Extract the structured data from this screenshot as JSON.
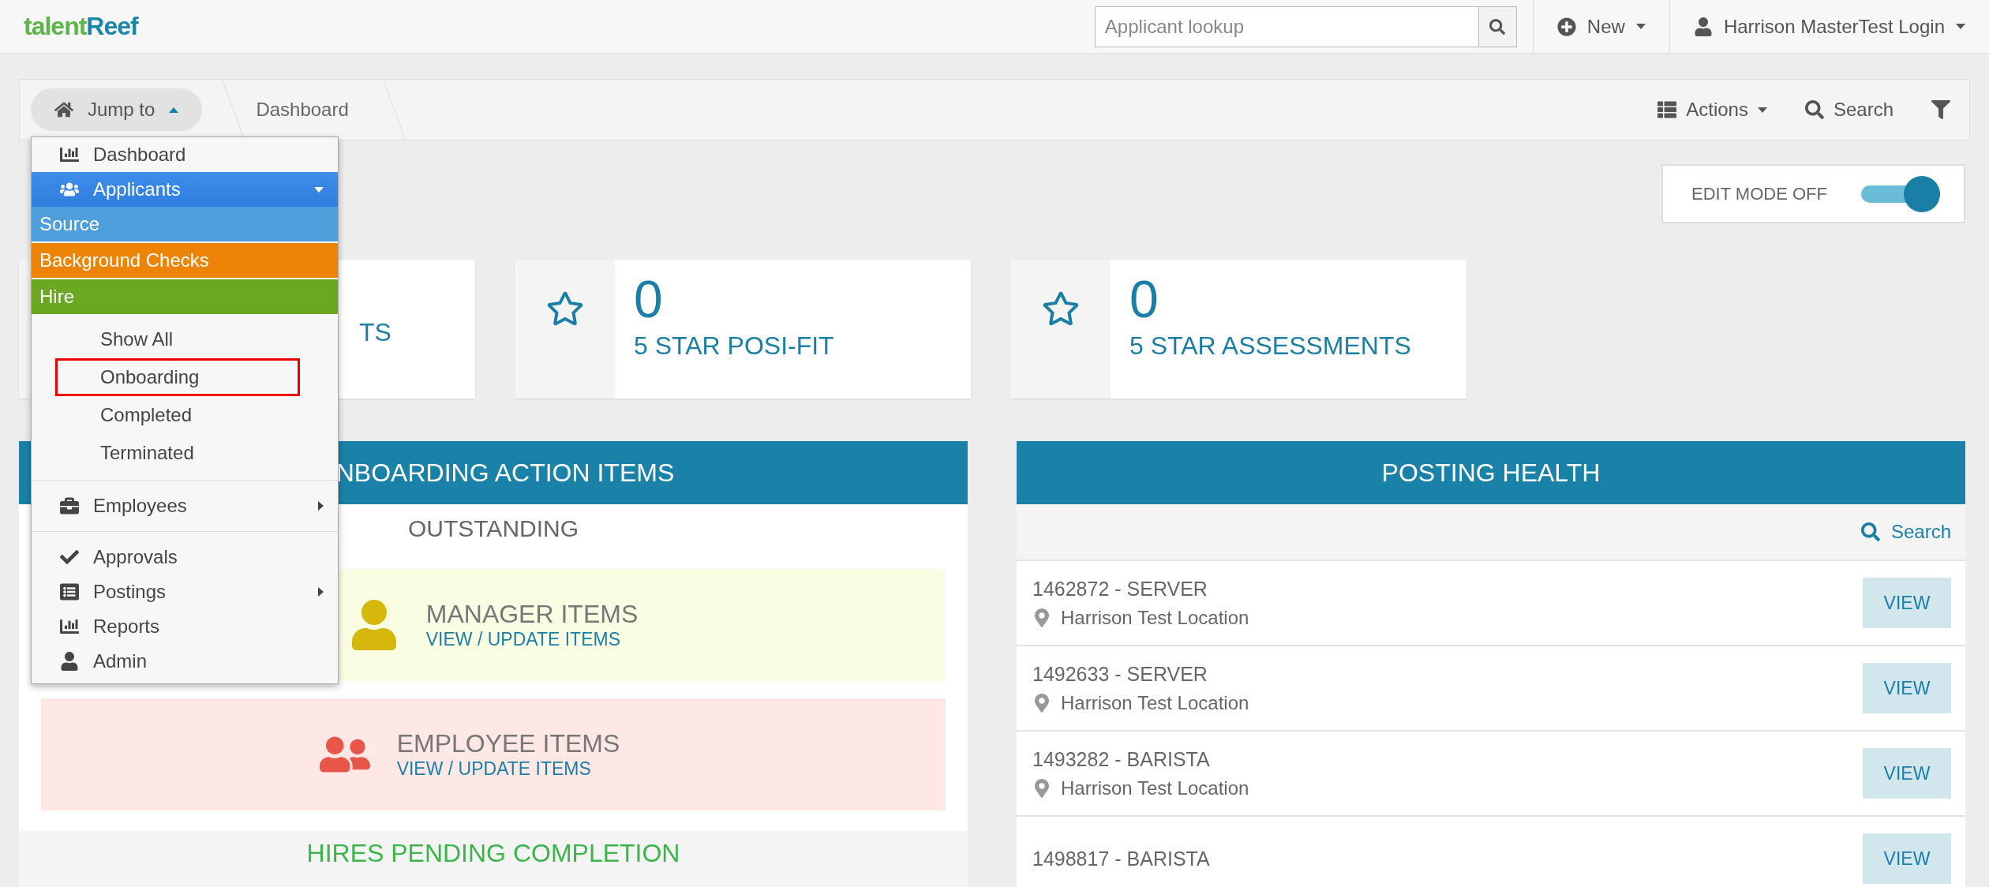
{
  "header": {
    "logo": {
      "part_1": "talent",
      "part_2": "Reef"
    },
    "lookup": {
      "placeholder": "Applicant lookup"
    },
    "new_button": "New",
    "user": "Harrison MasterTest Login"
  },
  "breadcrumb": {
    "jump_to": {
      "label": "Jump to",
      "expanded": true
    },
    "current": "Dashboard",
    "actions": "Actions",
    "search": "Search"
  },
  "jump_menu": {
    "top": [
      {
        "label": "Dashboard",
        "expanded": false
      },
      {
        "label": "Applicants",
        "expanded": true
      }
    ],
    "stages": [
      {
        "label": "Source",
        "color": "#4f9fdc"
      },
      {
        "label": "Background Checks",
        "color": "#ee8405"
      },
      {
        "label": "Hire",
        "color": "#6aa821"
      }
    ],
    "sub_items": [
      {
        "label": "Show All",
        "marked": false
      },
      {
        "label": "Onboarding",
        "marked": true
      },
      {
        "label": "Completed",
        "marked": false
      },
      {
        "label": "Terminated",
        "marked": false
      }
    ],
    "groups": [
      [
        {
          "label": "Employees",
          "submenu": true
        }
      ],
      [
        {
          "label": "Approvals",
          "submenu": false
        },
        {
          "label": "Postings",
          "submenu": true
        },
        {
          "label": "Reports",
          "submenu": false
        },
        {
          "label": "Admin",
          "submenu": false
        }
      ]
    ]
  },
  "edit_mode": {
    "label": "EDIT MODE OFF",
    "on": true
  },
  "stat_cards": [
    {
      "label": "TS"
    },
    {
      "value": "0",
      "label": "5 STAR POSI-FIT"
    },
    {
      "value": "0",
      "label": "5 STAR ASSESSMENTS"
    }
  ],
  "action_panel": {
    "title": "NBOARDING ACTION ITEMS",
    "subtitle": "OUTSTANDING",
    "items": [
      {
        "kind": "manager",
        "title": "MANAGER ITEMS",
        "link": "VIEW / UPDATE ITEMS"
      },
      {
        "kind": "employee",
        "title": "EMPLOYEE ITEMS",
        "link": "VIEW / UPDATE ITEMS"
      }
    ],
    "footer": "HIRES PENDING COMPLETION"
  },
  "posting_panel": {
    "title": "POSTING HEALTH",
    "search": "Search",
    "rows": [
      {
        "title": "1462872 - SERVER",
        "location": "Harrison Test Location",
        "button": "VIEW"
      },
      {
        "title": "1492633 - SERVER",
        "location": "Harrison Test Location",
        "button": "VIEW"
      },
      {
        "title": "1493282 - BARISTA",
        "location": "Harrison Test Location",
        "button": "VIEW"
      },
      {
        "title": "1498817 - BARISTA",
        "button": "VIEW"
      }
    ]
  }
}
